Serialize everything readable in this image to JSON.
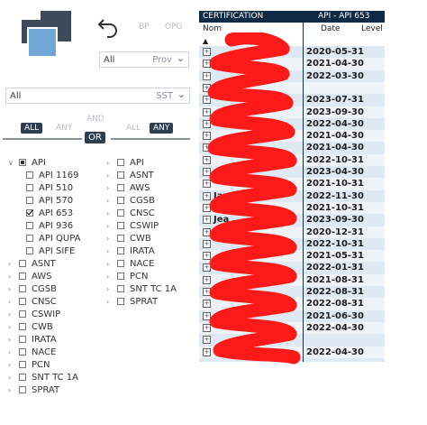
{
  "toolbar": {
    "back_icon": "undo-arrow-icon",
    "bp_label": "BP",
    "opg_label": "OPG"
  },
  "filters": {
    "top_dropdown": {
      "value": "All",
      "placeholder": "Prov"
    },
    "wide_dropdown": {
      "value": "All",
      "placeholder": "SST"
    }
  },
  "toggles": {
    "left": {
      "all": "ALL",
      "any": "ANY"
    },
    "middle": {
      "and": "AND",
      "or": "OR"
    },
    "right": {
      "all": "ALL",
      "any": "ANY"
    }
  },
  "left_slicer": {
    "items": [
      {
        "label": "API",
        "state": "partial",
        "level": 0,
        "expanded": true
      },
      {
        "label": "API 1169",
        "state": "none",
        "level": 1
      },
      {
        "label": "API 510",
        "state": "none",
        "level": 1
      },
      {
        "label": "API 570",
        "state": "none",
        "level": 1
      },
      {
        "label": "API 653",
        "state": "checked",
        "level": 1
      },
      {
        "label": "API 936",
        "state": "none",
        "level": 1
      },
      {
        "label": "API QUPA",
        "state": "none",
        "level": 1
      },
      {
        "label": "API SIFE",
        "state": "none",
        "level": 1
      },
      {
        "label": "ASNT",
        "state": "none",
        "level": 0
      },
      {
        "label": "AWS",
        "state": "none",
        "level": 0
      },
      {
        "label": "CGSB",
        "state": "none",
        "level": 0
      },
      {
        "label": "CNSC",
        "state": "none",
        "level": 0
      },
      {
        "label": "CSWIP",
        "state": "none",
        "level": 0
      },
      {
        "label": "CWB",
        "state": "none",
        "level": 0
      },
      {
        "label": "IRATA",
        "state": "none",
        "level": 0
      },
      {
        "label": "NACE",
        "state": "none",
        "level": 0
      },
      {
        "label": "PCN",
        "state": "none",
        "level": 0
      },
      {
        "label": "SNT TC 1A",
        "state": "none",
        "level": 0
      },
      {
        "label": "SPRAT",
        "state": "none",
        "level": 0
      }
    ]
  },
  "right_slicer": {
    "items": [
      {
        "label": "API"
      },
      {
        "label": "ASNT"
      },
      {
        "label": "AWS"
      },
      {
        "label": "CGSB"
      },
      {
        "label": "CNSC"
      },
      {
        "label": "CSWIP"
      },
      {
        "label": "CWB"
      },
      {
        "label": "IRATA"
      },
      {
        "label": "NACE"
      },
      {
        "label": "PCN"
      },
      {
        "label": "SNT TC 1A"
      },
      {
        "label": "SPRAT"
      }
    ]
  },
  "table": {
    "title_left": "CERTIFICATION",
    "title_right": "API - API 653",
    "columns": {
      "name": "Nom",
      "date": "Date",
      "level": "Level"
    },
    "rows": [
      {
        "name": "",
        "date": "2020-05-31"
      },
      {
        "name": "",
        "date": "2021-04-30"
      },
      {
        "name": "",
        "date": "2022-03-30"
      },
      {
        "name": "",
        "date": ""
      },
      {
        "name": "",
        "date": "2023-07-31"
      },
      {
        "name": "",
        "date": "2023-09-30"
      },
      {
        "name": "",
        "date": "2022-04-30"
      },
      {
        "name": "",
        "date": "2021-04-30"
      },
      {
        "name": "",
        "date": "2021-04-30"
      },
      {
        "name": "",
        "date": "2022-10-31"
      },
      {
        "name": "",
        "date": "2023-04-30"
      },
      {
        "name": "",
        "date": "2021-10-31"
      },
      {
        "name": "Jame",
        "date": "2022-11-30"
      },
      {
        "name": "",
        "date": "2021-10-31"
      },
      {
        "name": "Jea",
        "date": "2023-09-30"
      },
      {
        "name": "",
        "date": "2020-12-31"
      },
      {
        "name": "",
        "date": "2022-10-31"
      },
      {
        "name": "",
        "date": "2021-05-31"
      },
      {
        "name": "",
        "date": "2022-01-31"
      },
      {
        "name": "",
        "date": "2021-08-31"
      },
      {
        "name": "Ri",
        "date": "2022-08-31"
      },
      {
        "name": "",
        "date": "2022-08-31"
      },
      {
        "name": "",
        "date": "2021-06-30"
      },
      {
        "name": "",
        "date": "2022-04-30"
      },
      {
        "name": "",
        "date": ""
      },
      {
        "name": "",
        "date": "2022-04-30"
      }
    ]
  },
  "colors": {
    "header_navy": "#0f2a44",
    "redaction_red": "#ff1a1a",
    "table_bg": "#dfe9f3"
  }
}
